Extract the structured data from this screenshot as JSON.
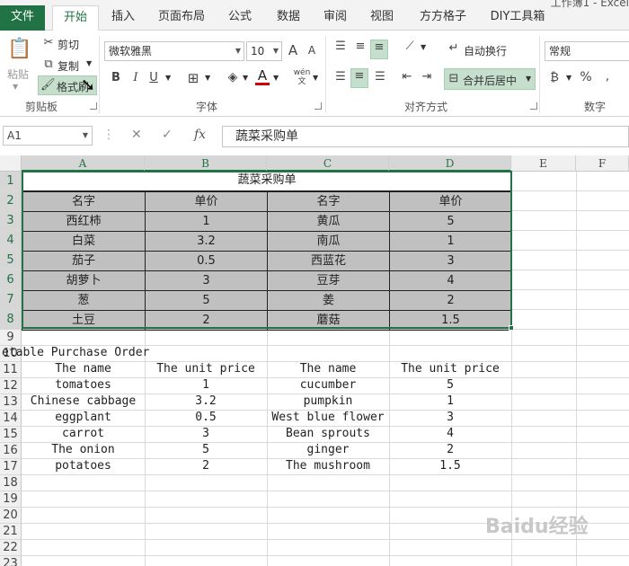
{
  "title_fragment": "工作簿1 - Excel",
  "tabs": [
    "文件",
    "开始",
    "插入",
    "页面布局",
    "公式",
    "数据",
    "审阅",
    "视图",
    "方方格子",
    "DIY工具箱"
  ],
  "clipboard": {
    "paste": "粘贴",
    "cut": "剪切",
    "copy": "复制",
    "format_painter": "格式刷",
    "label": "剪贴板"
  },
  "font": {
    "name": "微软雅黑",
    "size": "10",
    "bold": "B",
    "italic": "I",
    "underline": "U",
    "label": "字体",
    "phonetic": "wén",
    "grow": "A",
    "shrink": "A"
  },
  "alignment": {
    "wrap": "自动换行",
    "merge": "合并后居中",
    "label": "对齐方式"
  },
  "number": {
    "format": "常规",
    "percent": "%",
    "label": "数字"
  },
  "formula_bar": {
    "name_box": "A1",
    "cancel": "✕",
    "enter": "✓",
    "fx": "fx",
    "content": "蔬菜采购单"
  },
  "columns": [
    "A",
    "B",
    "C",
    "D",
    "E",
    "F"
  ],
  "rows": [
    "1",
    "2",
    "3",
    "4",
    "5",
    "6",
    "7",
    "8",
    "9",
    "10",
    "11",
    "12",
    "13",
    "14",
    "15",
    "16",
    "17",
    "18",
    "19",
    "20",
    "21",
    "22",
    "23"
  ],
  "table_cn": {
    "title": "蔬菜采购单",
    "headers": [
      "名字",
      "单价",
      "名字",
      "单价"
    ],
    "rows": [
      [
        "西红柿",
        "1",
        "黄瓜",
        "5"
      ],
      [
        "白菜",
        "3.2",
        "南瓜",
        "1"
      ],
      [
        "茄子",
        "0.5",
        "西蓝花",
        "3"
      ],
      [
        "胡萝卜",
        "3",
        "豆芽",
        "4"
      ],
      [
        "葱",
        "5",
        "姜",
        "2"
      ],
      [
        "土豆",
        "2",
        "蘑菇",
        "1.5"
      ]
    ]
  },
  "table_en": {
    "title": "etable Purchase Order",
    "headers": [
      "The name",
      "The unit price",
      "The name",
      "The unit price"
    ],
    "rows": [
      [
        "tomatoes",
        "1",
        "cucumber",
        "5"
      ],
      [
        "Chinese cabbage",
        "3.2",
        "pumpkin",
        "1"
      ],
      [
        "eggplant",
        "0.5",
        "West blue flower",
        "3"
      ],
      [
        "carrot",
        "3",
        "Bean sprouts",
        "4"
      ],
      [
        "The onion",
        "5",
        "ginger",
        "2"
      ],
      [
        "potatoes",
        "2",
        "The mushroom",
        "1.5"
      ]
    ]
  },
  "watermark": "Baidu经验",
  "colors": {
    "excel_green": "#217346",
    "cell_gray": "#c0c0c0"
  }
}
